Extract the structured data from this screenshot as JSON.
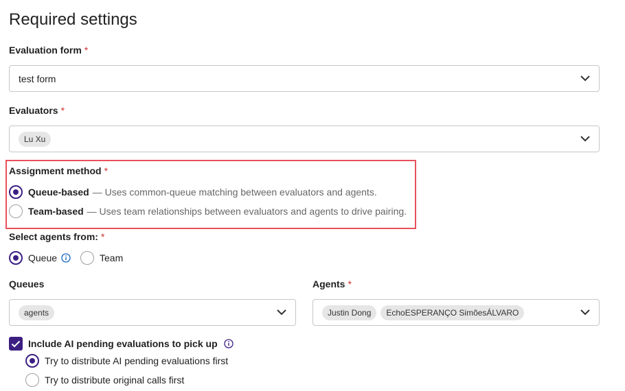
{
  "page": {
    "title": "Required settings",
    "required_marker": "*"
  },
  "evaluation_form": {
    "label": "Evaluation form",
    "value": "test form"
  },
  "evaluators": {
    "label": "Evaluators",
    "chips": [
      "Lu Xu"
    ]
  },
  "assignment_method": {
    "label": "Assignment method",
    "options": [
      {
        "label": "Queue-based",
        "description": "— Uses common-queue matching between evaluators and agents.",
        "selected": true
      },
      {
        "label": "Team-based",
        "description": "— Uses team relationships between evaluators and agents to drive pairing.",
        "selected": false
      }
    ]
  },
  "select_agents_from": {
    "label": "Select agents from:",
    "options": [
      {
        "label": "Queue",
        "selected": true
      },
      {
        "label": "Team",
        "selected": false
      }
    ]
  },
  "queues": {
    "label": "Queues",
    "chips": [
      "agents"
    ]
  },
  "agents": {
    "label": "Agents",
    "chips": [
      "Justin Dong",
      "EchoESPERANÇO SimõesÁLVARO"
    ]
  },
  "ai_pending": {
    "label": "Include AI pending evaluations to pick up",
    "checked": true,
    "options": [
      {
        "label": "Try to distribute AI pending evaluations first",
        "selected": true
      },
      {
        "label": "Try to distribute original calls first",
        "selected": false
      }
    ]
  },
  "colors": {
    "accent": "#3d1f82",
    "required": "#d32f2f",
    "highlight": "#e8505b",
    "info": "#1565c0"
  }
}
